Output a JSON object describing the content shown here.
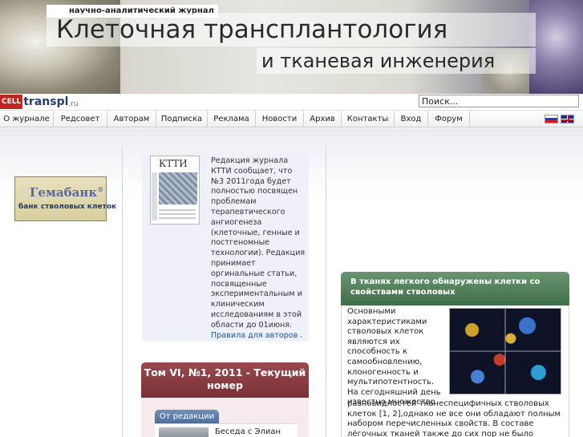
{
  "header": {
    "journal_tag": "научно-аналитический журнал",
    "title": "Клеточная трансплантология",
    "subtitle": "и тканевая инженерия"
  },
  "logo": {
    "cell": "CELL",
    "text": "transpl",
    "suffix": ".ru"
  },
  "search": {
    "value": "Поиск..."
  },
  "nav": {
    "items": [
      "О журнале",
      "Редсовет",
      "Авторам",
      "Подписка",
      "Реклама",
      "Новости",
      "Архив",
      "Контакты",
      "Вход",
      "Форум"
    ]
  },
  "languages": [
    "ru-flag-icon",
    "en-flag-icon"
  ],
  "hemabank": {
    "name": "Гемабанк",
    "mark": "®",
    "tagline": "банк стволовых клеток"
  },
  "news": {
    "cover_title": "КТТИ",
    "text": "Редакция журнала КТТИ сообщает, что №3  2011года будет полностью посвящен проблемам терапевтического ангиогенеза (клеточные, генные и постгеномные технологии). Редакция принимает оргинальные статьи, посвященные экспериментальным и клиническим исследованиям в  этой области до  01июня.",
    "link": "Правила для авторов ."
  },
  "issue": {
    "title": "Том VI, №1, 2011 - Текущий номер"
  },
  "editorial": {
    "tag": "От редакции",
    "title": "Беседа с Элиан"
  },
  "feature": {
    "title": "В тканях легкого обнаружены клетки со свойствами стволовых",
    "text_a": "Основными характеристиками стволовых клеток являются их способность к самообновлению, клоногенность и мультипотентность. На сегодняшний день известно множество",
    "text_b": "разновидностей тканеспецифичных стволовых клеток [1,  2],однако не все они обладают полным набором перечисленных свойств. В составе лёгочных тканей также до сих пор не было обнаружено  «истинных»"
  },
  "colors": {
    "issue_header": "#8a3b42",
    "feature_header": "#4f7d57",
    "editorial_tag": "#5d7ea9",
    "link": "#1f4d9c"
  }
}
